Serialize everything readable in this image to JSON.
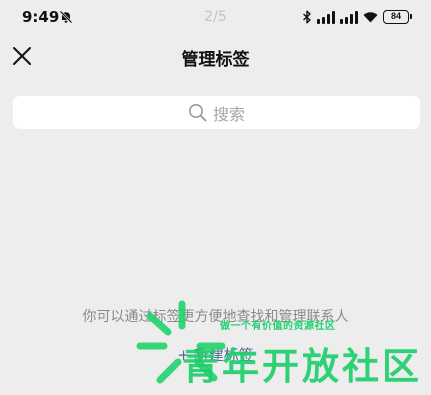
{
  "status_bar": {
    "time": "9:49",
    "page_indicator": "2/5",
    "battery": "84",
    "icons": [
      "mute-bell-icon",
      "bluetooth-icon",
      "signal-icon",
      "signal-icon",
      "wifi-icon",
      "battery-icon"
    ]
  },
  "nav": {
    "title": "管理标签",
    "close_icon": "close-icon"
  },
  "search": {
    "placeholder": "搜索",
    "icon": "search-icon"
  },
  "empty_state": {
    "hint": "你可以通过标签更方便地查找和管理联系人",
    "new_tag_plus": "+",
    "new_tag_label": "新建标签"
  },
  "watermark": {
    "subtitle": "做一个有价值的资源社区",
    "title": "青年开放社区"
  },
  "colors": {
    "background": "#ededed",
    "link": "#576b95",
    "hint": "#8a8a8a",
    "watermark": "#1ecf6c"
  }
}
